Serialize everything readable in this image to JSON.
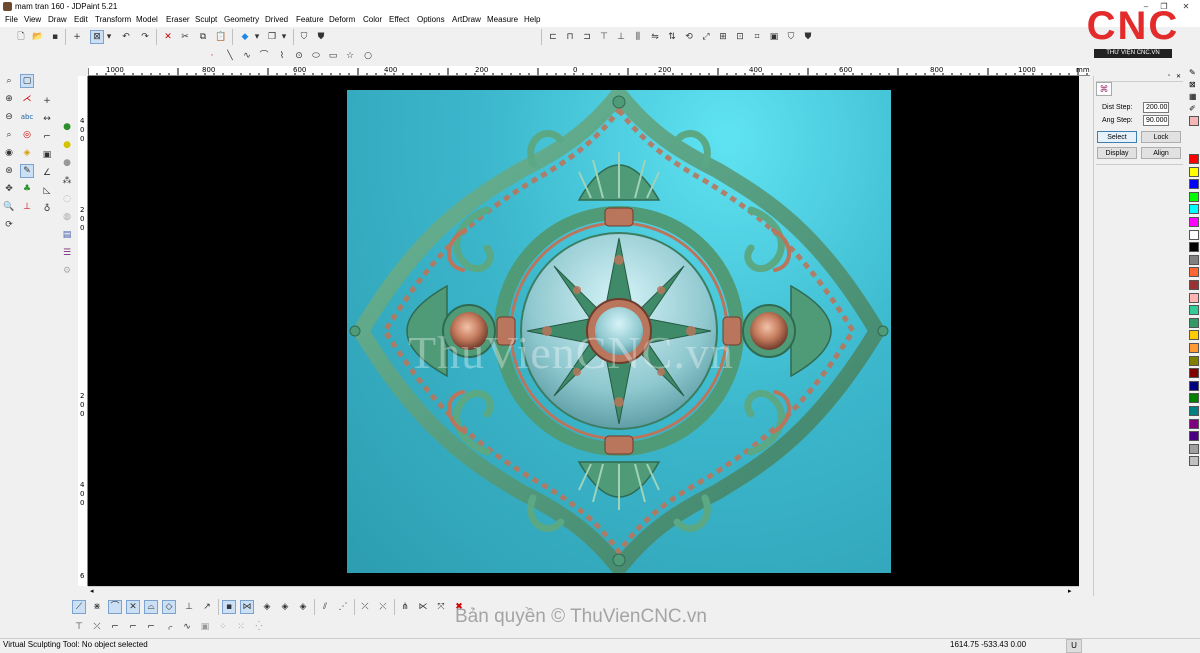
{
  "window": {
    "title": "mam tran 160 - JDPaint 5.21"
  },
  "menu": [
    "File",
    "View",
    "Draw",
    "Edit",
    "Transform",
    "Model",
    "Eraser",
    "Sculpt",
    "Geometry",
    "Drived",
    "Feature",
    "Deform",
    "Color",
    "Effect",
    "Options",
    "ArtDraw",
    "Measure",
    "Help"
  ],
  "ruler": {
    "h_labels": [
      "1000",
      "800",
      "600",
      "400",
      "200",
      "0",
      "200",
      "400",
      "600",
      "800",
      "1000",
      "mm"
    ],
    "v_labels": [
      "4",
      "0",
      "0",
      "2",
      "0",
      "0",
      "2",
      "0",
      "0",
      "4",
      "0",
      "0",
      "6"
    ]
  },
  "panel": {
    "dist_step_label": "Dist Step:",
    "dist_step_value": "200.00",
    "ang_step_label": "Ang Step:",
    "ang_step_value": "90.000",
    "select_label": "Select",
    "lock_label": "Lock",
    "display_label": "Display",
    "align_label": "Align"
  },
  "palette": [
    "#ff0000",
    "#ffff00",
    "#0000ff",
    "#00ff00",
    "#00ffff",
    "#ff00ff",
    "#ffffff",
    "#000000",
    "#808080",
    "#ff6633",
    "#993333",
    "#ffb3b3",
    "#33cc99",
    "#339966",
    "#ffcc00",
    "#ff9933",
    "#808000",
    "#800000",
    "#000080",
    "#008000",
    "#008080",
    "#800080",
    "#4b0082",
    "#a0a0a0",
    "#c0c0c0"
  ],
  "viewport": {
    "watermark": "ThuVienCNC.vn"
  },
  "status": {
    "message": "Virtual Sculpting Tool: No object selected",
    "coords": "1614.75 -533.43 0.00",
    "mode": "U"
  },
  "logo": {
    "text": "CNC",
    "tagline": "THƯ VIỆN CNC.VN"
  },
  "copyright": "Bản quyền © ThuVienCNC.vn",
  "accent": {
    "relief_teal": "#2d9db1",
    "ornament_green": "#4f9a77",
    "ornament_copper": "#b9765c",
    "logo_red": "#e32b2b"
  }
}
